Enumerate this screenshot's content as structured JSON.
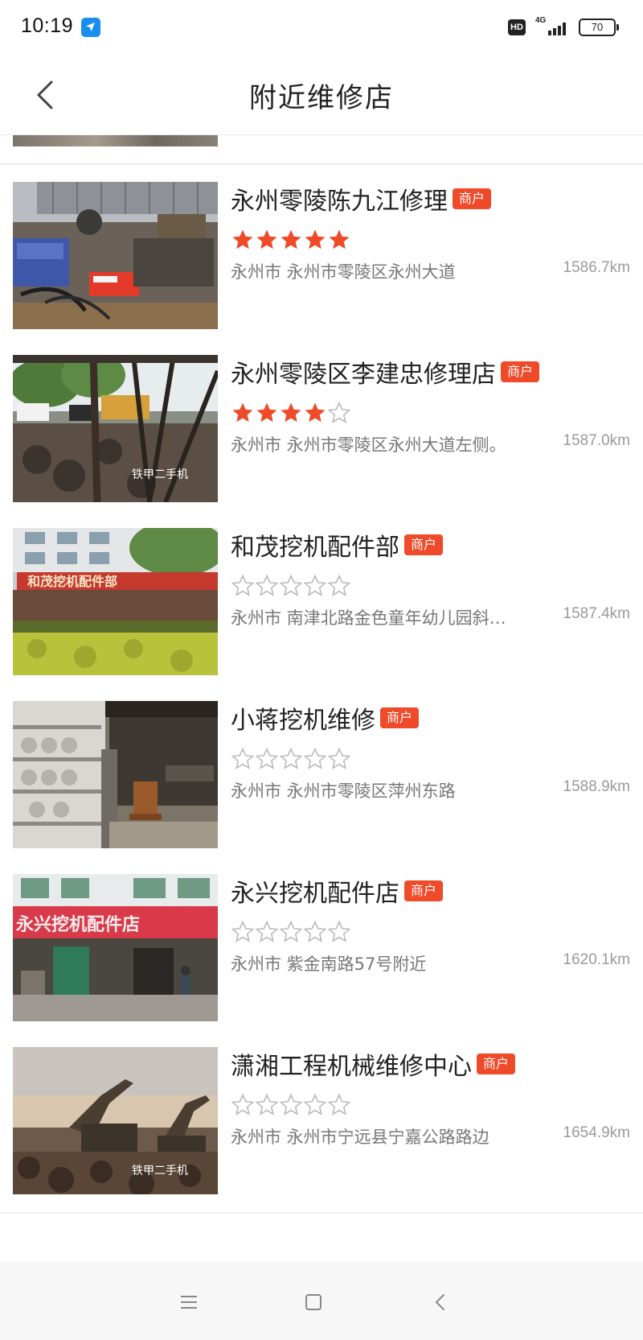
{
  "status_bar": {
    "time": "10:19",
    "app_icon": "paper-plane-icon",
    "hd_label": "HD",
    "network_label": "4G",
    "battery": "70"
  },
  "header": {
    "title": "附近维修店",
    "back_icon": "chevron-left-icon"
  },
  "colors": {
    "accent": "#ef4a2a",
    "star_filled": "#ef4a2a",
    "star_empty": "#bbbbbb",
    "text_primary": "#222222",
    "text_secondary": "#777777"
  },
  "shops": [
    {
      "name": "永州零陵陈九江修理",
      "badge": "商户",
      "rating": 5,
      "address": "永州市 永州市零陵区永州大道",
      "distance": "1586.7km"
    },
    {
      "name": "永州零陵区李建忠修理店",
      "badge": "商户",
      "rating": 4,
      "address": "永州市 永州市零陵区永州大道左侧。",
      "distance": "1587.0km"
    },
    {
      "name": "和茂挖机配件部",
      "badge": "商户",
      "rating": 0,
      "address": "永州市 南津北路金色童年幼儿园斜…",
      "distance": "1587.4km"
    },
    {
      "name": "小蒋挖机维修",
      "badge": "商户",
      "rating": 0,
      "address": "永州市 永州市零陵区萍州东路",
      "distance": "1588.9km"
    },
    {
      "name": "永兴挖机配件店",
      "badge": "商户",
      "rating": 0,
      "address": "永州市 紫金南路57号附近",
      "distance": "1620.1km"
    },
    {
      "name": "潇湘工程机械维修中心",
      "badge": "商户",
      "rating": 0,
      "address": "永州市 永州市宁远县宁嘉公路路边",
      "distance": "1654.9km"
    }
  ],
  "nav_bar": {
    "menu_icon": "menu-icon",
    "home_icon": "home-square-icon",
    "back_icon": "back-triangle-icon"
  }
}
